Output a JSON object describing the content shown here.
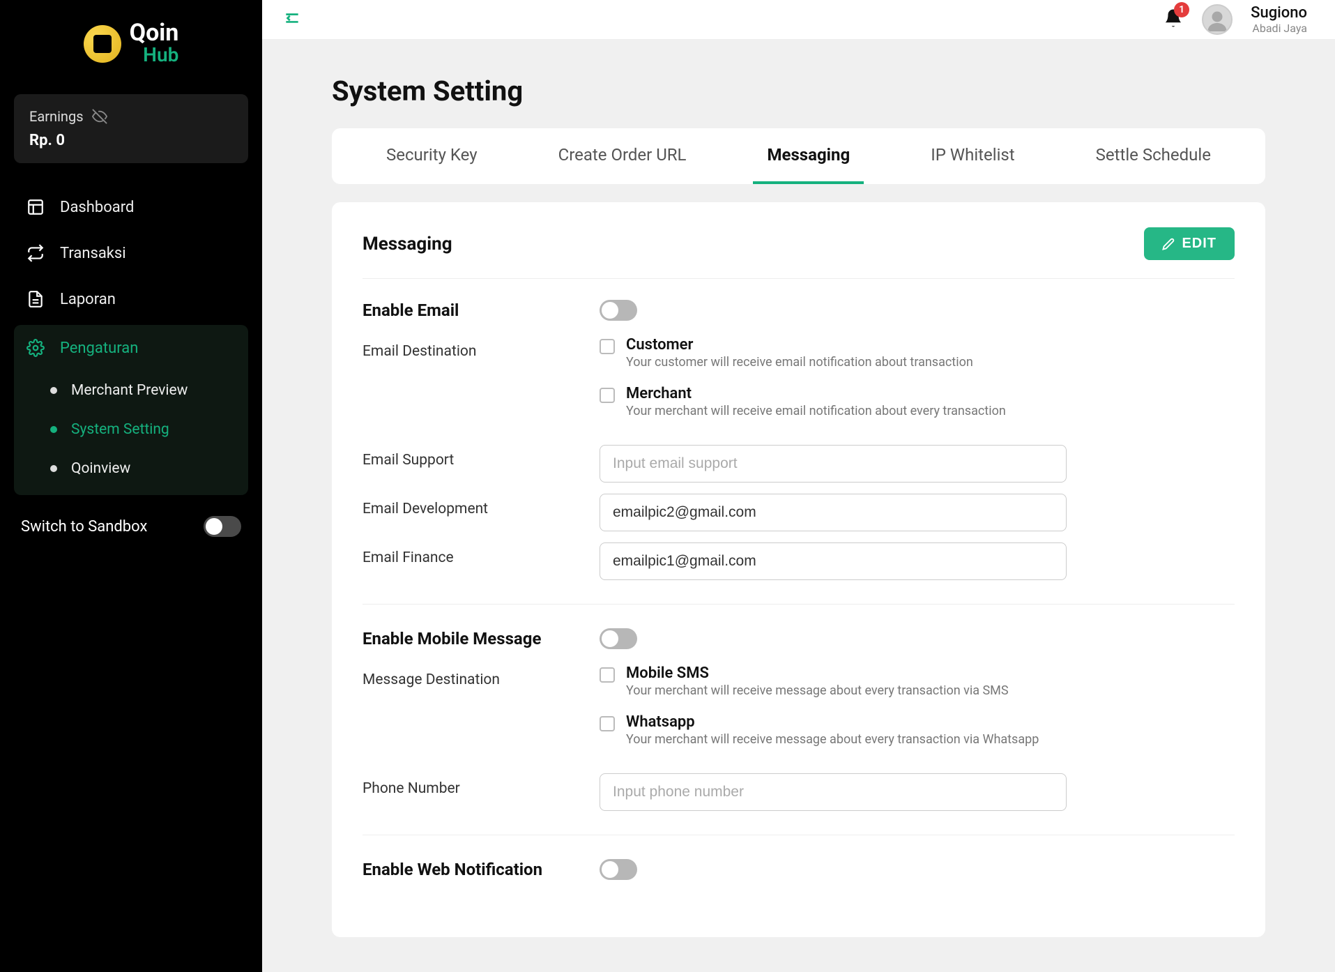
{
  "logo": {
    "main": "Qoin",
    "sub": "Hub"
  },
  "earnings": {
    "label": "Earnings",
    "value": "Rp. 0"
  },
  "nav": {
    "dashboard": "Dashboard",
    "transaksi": "Transaksi",
    "laporan": "Laporan",
    "pengaturan": "Pengaturan",
    "sub": {
      "merchant_preview": "Merchant Preview",
      "system_setting": "System Setting",
      "qoinview": "Qoinview"
    }
  },
  "sandbox_label": "Switch to Sandbox",
  "topbar": {
    "badge": "1",
    "user_name": "Sugiono",
    "user_company": "Abadi Jaya"
  },
  "page_title": "System Setting",
  "tabs": {
    "security_key": "Security Key",
    "create_order_url": "Create Order URL",
    "messaging": "Messaging",
    "ip_whitelist": "IP Whitelist",
    "settle_schedule": "Settle Schedule"
  },
  "panel": {
    "title": "Messaging",
    "edit": "EDIT",
    "enable_email": "Enable Email",
    "email_destination": {
      "label": "Email Destination",
      "customer": {
        "title": "Customer",
        "desc": "Your customer will receive email notification about transaction"
      },
      "merchant": {
        "title": "Merchant",
        "desc": "Your merchant will receive email notification about every transaction"
      }
    },
    "email_support": {
      "label": "Email Support",
      "placeholder": "Input email support",
      "value": ""
    },
    "email_development": {
      "label": "Email Development",
      "value": "emailpic2@gmail.com"
    },
    "email_finance": {
      "label": "Email Finance",
      "value": "emailpic1@gmail.com"
    },
    "enable_mobile": "Enable Mobile Message",
    "message_destination": {
      "label": "Message Destination",
      "sms": {
        "title": "Mobile SMS",
        "desc": "Your merchant will receive message about every transaction via SMS"
      },
      "whatsapp": {
        "title": "Whatsapp",
        "desc": "Your merchant will receive message about every transaction via Whatsapp"
      }
    },
    "phone": {
      "label": "Phone Number",
      "placeholder": "Input phone number",
      "value": ""
    },
    "enable_web": "Enable Web Notification"
  }
}
